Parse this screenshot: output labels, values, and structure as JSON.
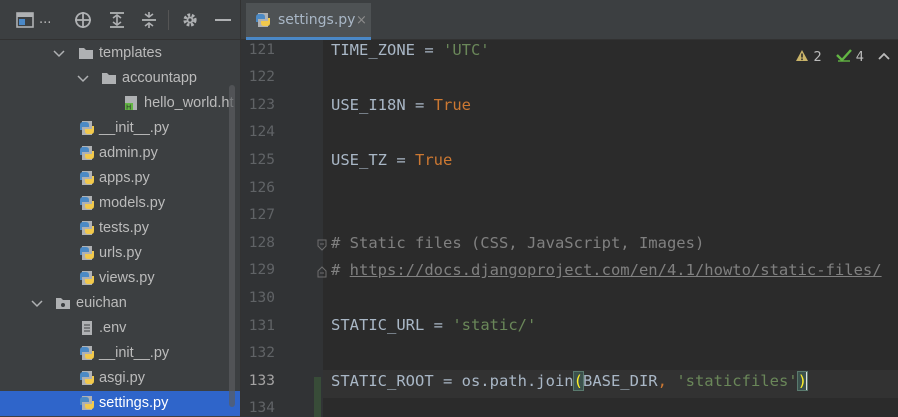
{
  "project_panel": {
    "title": "..."
  },
  "tree": [
    {
      "label": "templates",
      "type": "folder"
    },
    {
      "label": "accountapp",
      "type": "folder"
    },
    {
      "label": "hello_world.ht",
      "type": "html"
    },
    {
      "label": "__init__.py",
      "type": "py"
    },
    {
      "label": "admin.py",
      "type": "py"
    },
    {
      "label": "apps.py",
      "type": "py"
    },
    {
      "label": "models.py",
      "type": "py"
    },
    {
      "label": "tests.py",
      "type": "py"
    },
    {
      "label": "urls.py",
      "type": "py"
    },
    {
      "label": "views.py",
      "type": "py"
    },
    {
      "label": "euichan",
      "type": "package"
    },
    {
      "label": ".env",
      "type": "file"
    },
    {
      "label": "__init__.py",
      "type": "py"
    },
    {
      "label": "asgi.py",
      "type": "py"
    },
    {
      "label": "settings.py",
      "type": "py"
    }
  ],
  "editor": {
    "tab": {
      "label": "settings.py",
      "close": "×"
    },
    "inspections": {
      "warnings": "2",
      "checks": "4"
    },
    "line_numbers": [
      "121",
      "122",
      "123",
      "124",
      "125",
      "126",
      "127",
      "128",
      "129",
      "130",
      "131",
      "132",
      "133",
      "134"
    ],
    "lines": {
      "l121": {
        "name": "TIME_ZONE = ",
        "value": "'UTC'"
      },
      "l123": {
        "name": "USE_I18N = ",
        "value": "True"
      },
      "l125": {
        "name": "USE_TZ = ",
        "value": "True"
      },
      "l128": {
        "comment": "# Static files (CSS, JavaScript, Images)"
      },
      "l129": {
        "hash": "# ",
        "url": "https://docs.djangoproject.com/en/4.1/howto/static-files/"
      },
      "l131": {
        "name": "STATIC_URL = ",
        "value": "'static/'"
      },
      "l133": {
        "name": "STATIC_ROOT = os.path.join",
        "open": "(",
        "arg1": "BASE_DIR",
        "comma": ", ",
        "arg2": "'staticfiles'",
        "close": ")"
      }
    }
  },
  "colors": {
    "panel": "#3c3f41",
    "editor": "#2b2b2b",
    "selection": "#2f65ca",
    "keyword": "#cc7832",
    "string": "#6a8759",
    "comment": "#808080"
  }
}
